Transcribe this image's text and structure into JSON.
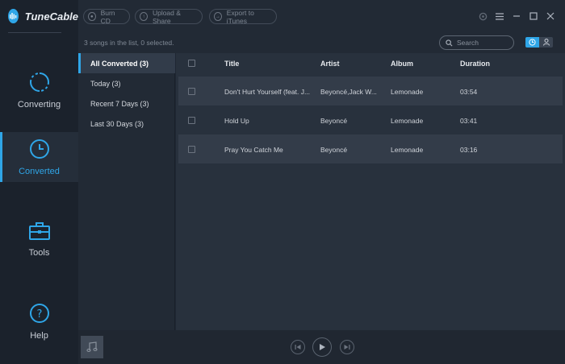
{
  "app": {
    "name": "TuneCable"
  },
  "sidebar": {
    "items": [
      {
        "label": "Converting",
        "icon": "converting-icon",
        "active": false
      },
      {
        "label": "Converted",
        "icon": "clock-icon",
        "active": true
      },
      {
        "label": "Tools",
        "icon": "toolbox-icon",
        "active": false
      },
      {
        "label": "Help",
        "icon": "help-icon",
        "active": false
      }
    ]
  },
  "toolbar": {
    "burn_label": "Burn CD",
    "upload_label": "Upload & Share",
    "export_label": "Export to iTunes"
  },
  "status": {
    "count_text": "3 songs in the list, 0 selected.",
    "search_placeholder": "Search"
  },
  "filters": [
    {
      "label": "All Converted (3)",
      "active": true
    },
    {
      "label": "Today (3)",
      "active": false
    },
    {
      "label": "Recent 7 Days (3)",
      "active": false
    },
    {
      "label": "Last 30 Days (3)",
      "active": false
    }
  ],
  "table": {
    "columns": {
      "title": "Title",
      "artist": "Artist",
      "album": "Album",
      "duration": "Duration"
    },
    "rows": [
      {
        "title": "Don't Hurt Yourself (feat. J...",
        "artist": "Beyoncé,Jack W...",
        "album": "Lemonade",
        "duration": "03:54"
      },
      {
        "title": "Hold Up",
        "artist": "Beyoncé",
        "album": "Lemonade",
        "duration": "03:41"
      },
      {
        "title": "Pray You Catch Me",
        "artist": "Beyoncé",
        "album": "Lemonade",
        "duration": "03:16"
      }
    ]
  },
  "colors": {
    "accent": "#2fa6e8",
    "sidebar_bg": "#1b222c",
    "panel_bg": "#222a35",
    "table_bg": "#28313d"
  }
}
